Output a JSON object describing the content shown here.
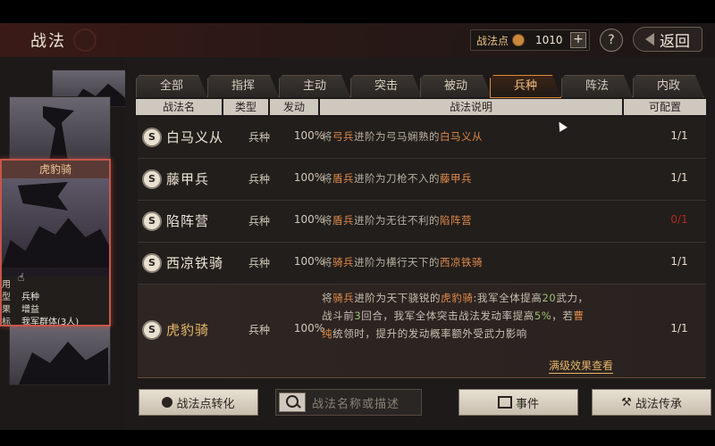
{
  "header": {
    "title": "战法",
    "points_label": "战法点",
    "points_value": "1010",
    "plus": "+",
    "help": "?",
    "back_label": "返回"
  },
  "left_panel": {
    "selected_card": {
      "title": "虎豹骑",
      "info": [
        {
          "key": "用",
          "value": ""
        },
        {
          "key": "型",
          "value": "兵种"
        },
        {
          "key": "果",
          "value": "增益"
        },
        {
          "key": "标",
          "value": "我军群体(3人)"
        }
      ]
    }
  },
  "tabs": [
    {
      "label": "全部",
      "active": false
    },
    {
      "label": "指挥",
      "active": false
    },
    {
      "label": "主动",
      "active": false
    },
    {
      "label": "突击",
      "active": false
    },
    {
      "label": "被动",
      "active": false
    },
    {
      "label": "兵种",
      "active": true
    },
    {
      "label": "阵法",
      "active": false
    },
    {
      "label": "内政",
      "active": false
    }
  ],
  "table": {
    "headers": {
      "name": "战法名",
      "type": "类型",
      "rate": "发动",
      "desc": "战法说明",
      "slots": "可配置"
    },
    "rows": [
      {
        "badge": "S",
        "name": "白马义从",
        "type": "兵种",
        "rate": "100%",
        "desc": {
          "p1": "将",
          "h1": "弓兵",
          "p2": "进阶为弓马娴熟的",
          "h2": "白马义从"
        },
        "slots": "1/1"
      },
      {
        "badge": "S",
        "name": "藤甲兵",
        "type": "兵种",
        "rate": "100%",
        "desc": {
          "p1": "将",
          "h1": "盾兵",
          "p2": "进阶为刀枪不入的",
          "h2": "藤甲兵"
        },
        "slots": "1/1"
      },
      {
        "badge": "S",
        "name": "陷阵营",
        "type": "兵种",
        "rate": "100%",
        "desc": {
          "p1": "将",
          "h1": "盾兵",
          "p2": "进阶为无往不利的",
          "h2": "陷阵营"
        },
        "slots": "0/1"
      },
      {
        "badge": "S",
        "name": "西凉铁骑",
        "type": "兵种",
        "rate": "100%",
        "desc": {
          "p1": "将",
          "h1": "骑兵",
          "p2": "进阶为横行天下的",
          "h2": "西凉铁骑"
        },
        "slots": "1/1"
      },
      {
        "badge": "S",
        "name": "虎豹骑",
        "type": "兵种",
        "rate": "100%",
        "desc_lines": {
          "l1_a": "将",
          "l1_h1": "骑兵",
          "l1_b": "进阶为天下骁锐的",
          "l1_h2": "虎豹骑",
          "l1_c": ":我军全体提高",
          "l1_n": "20",
          "l1_d": "武力，",
          "l2_a": "战斗前",
          "l2_n": "3",
          "l2_b": "回合，我军全体突击战法发动率提高",
          "l2_p": "5%",
          "l2_c": "，若",
          "l2_h": "曹",
          "l3_h": "纯",
          "l3_a": "统领时，提升的发动概率额外受武力影响"
        },
        "slots": "1/1",
        "view_full": "满级效果查看"
      }
    ]
  },
  "bottom": {
    "convert_label": "战法点转化",
    "search_placeholder": "战法名称或描述",
    "event_label": "事件",
    "inherit_label": "战法传承"
  }
}
